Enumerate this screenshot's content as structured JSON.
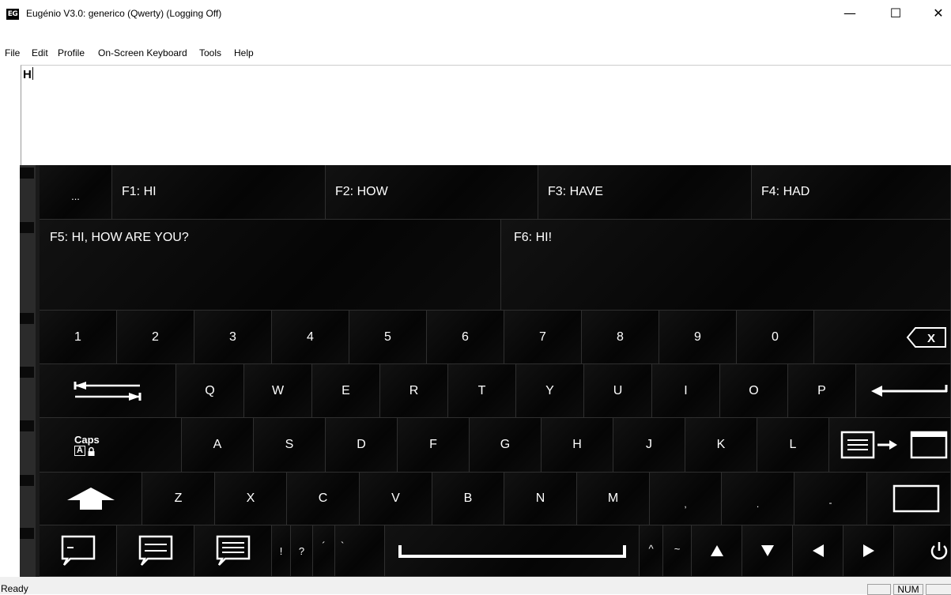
{
  "window": {
    "icon_text": "EG",
    "title": "Eugénio V3.0: generico (Qwerty) (Logging Off)",
    "minimize": "—",
    "maximize": "☐",
    "close": "✕"
  },
  "menu": [
    "File",
    "Edit",
    "Profile",
    "On-Screen Keyboard",
    "Tools",
    "Help"
  ],
  "editor": {
    "text": "H"
  },
  "predictions": {
    "more": "...",
    "row1": [
      "F1: HI",
      "F2: HOW",
      "F3: HAVE",
      "F4: HAD"
    ],
    "row2": [
      "F5: HI, HOW ARE YOU?",
      "F6: HI!"
    ]
  },
  "keys": {
    "numbers": [
      "1",
      "2",
      "3",
      "4",
      "5",
      "6",
      "7",
      "8",
      "9",
      "0"
    ],
    "row_q": [
      "Q",
      "W",
      "E",
      "R",
      "T",
      "Y",
      "U",
      "I",
      "O",
      "P"
    ],
    "row_a": [
      "A",
      "S",
      "D",
      "F",
      "G",
      "H",
      "J",
      "K",
      "L"
    ],
    "row_z": [
      "Z",
      "X",
      "C",
      "V",
      "B",
      "N",
      "M",
      ",",
      ".",
      "-"
    ],
    "caps": "Caps",
    "caps_badge": "A",
    "punct": [
      "!",
      "?",
      "´",
      "`"
    ],
    "accents": [
      "^",
      "~"
    ],
    "backspace": "X"
  },
  "icons": {
    "backspace": "backspace-icon",
    "tab": "tab-icon",
    "enter": "enter-icon",
    "caps": "caps-lock-icon",
    "switch_layout": "switch-layout-icon",
    "shift": "shift-icon",
    "empty": "empty-key-icon",
    "speech_small": "speech-one-line-icon",
    "speech_medium": "speech-two-lines-icon",
    "speech_large": "speech-three-lines-icon",
    "space": "space-icon",
    "power": "power-icon"
  },
  "status": {
    "text": "Ready",
    "num": "NUM",
    "panes": [
      "",
      "NUM",
      ""
    ]
  }
}
